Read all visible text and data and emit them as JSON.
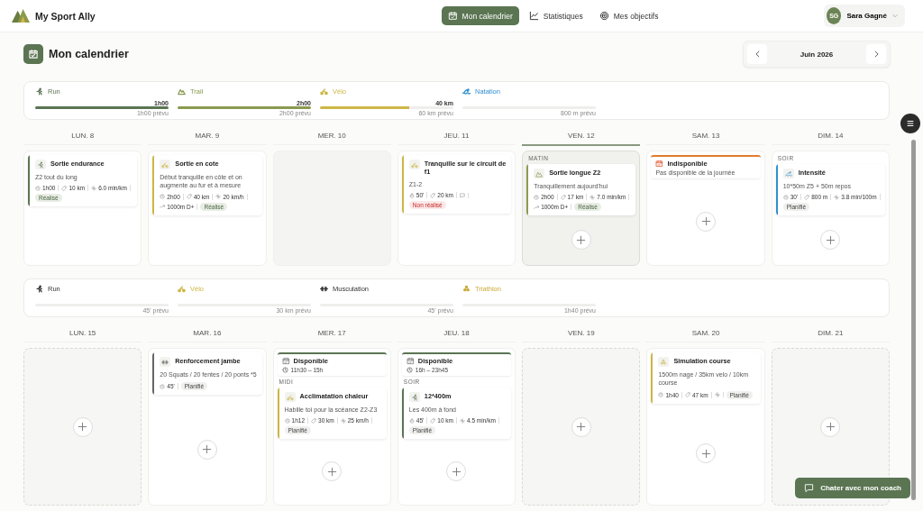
{
  "app": {
    "name": "My Sport Ally"
  },
  "nav": [
    {
      "label": "Mon calendrier",
      "kind": "calendar",
      "selected": true
    },
    {
      "label": "Statistiques",
      "kind": "chart",
      "selected": false
    },
    {
      "label": "Mes objectifs",
      "kind": "target",
      "selected": false
    }
  ],
  "user": {
    "initials": "SG",
    "name": "Sara Gagné"
  },
  "page": {
    "title": "Mon calendrier",
    "month": "Juin 2026"
  },
  "weeks": [
    {
      "summary": [
        {
          "kind": "run",
          "label": "Run",
          "color": "#5b7553",
          "done": "1h00",
          "level": 1,
          "planned": "1h00 prévu"
        },
        {
          "kind": "trail",
          "label": "Trail",
          "color": "#8a9a50",
          "done": "2h00",
          "level": 1,
          "planned": "2h00 prévu"
        },
        {
          "kind": "velo",
          "label": "Vélo",
          "color": "#cdb646",
          "done": "40 km",
          "level": 0.67,
          "planned": "60 km prévu"
        },
        {
          "kind": "natation",
          "label": "Natation",
          "color": "#2f8fcf",
          "level": 0,
          "planned": "800 m prévu"
        }
      ],
      "days": [
        {
          "label": "LUN. 8",
          "selected": false,
          "kind": "plain",
          "add_button": false,
          "items": [
            {
              "kind": "run",
              "color": "#5b7553",
              "title": "Sortie endurance",
              "description": "Z2 tout du long",
              "stats": [
                {
                  "kind": "clock",
                  "text": "1h00"
                },
                {
                  "kind": "distance",
                  "text": "10 km"
                },
                {
                  "kind": "pace",
                  "text": "6.0 min/km"
                }
              ],
              "status": {
                "kind": "done",
                "label": "Réalisé"
              }
            }
          ]
        },
        {
          "label": "MAR. 9",
          "selected": false,
          "kind": "plain",
          "add_button": false,
          "items": [
            {
              "kind": "velo",
              "color": "#cdb646",
              "title": "Sortie en cote",
              "description": "Début tranquille en côte et on augmente au fur et à mesure",
              "stats": [
                {
                  "kind": "clock",
                  "text": "2h00"
                },
                {
                  "kind": "distance",
                  "text": "40 km"
                },
                {
                  "kind": "pace",
                  "text": "20 km/h"
                },
                {
                  "kind": "elevation",
                  "text": "1000m D+"
                }
              ],
              "status": {
                "kind": "done",
                "label": "Réalisé"
              }
            }
          ]
        },
        {
          "label": "MER. 10",
          "selected": false,
          "kind": "past",
          "add_button": false
        },
        {
          "label": "JEU. 11",
          "selected": false,
          "kind": "plain",
          "add_button": false,
          "items": [
            {
              "kind": "velo",
              "color": "#cdb646",
              "title": "Tranquille sur le circuit de f1",
              "description": "Z1-2",
              "stats": [
                {
                  "kind": "timer",
                  "text": "50'"
                },
                {
                  "kind": "distance",
                  "text": "20 km"
                },
                {
                  "kind": "comment"
                }
              ],
              "status": {
                "kind": "missed",
                "label": "Non réalisé"
              }
            }
          ]
        },
        {
          "label": "VEN. 12",
          "selected": true,
          "kind": "plain",
          "add_button": true,
          "items": [
            {
              "kind": "period",
              "text": "MATIN"
            },
            {
              "kind": "trail",
              "color": "#8a9a50",
              "title": "Sortie longue Z2",
              "description": "Tranquillement aujourd'hui",
              "stats": [
                {
                  "kind": "clock",
                  "text": "2h00"
                },
                {
                  "kind": "distance",
                  "text": "17 km"
                },
                {
                  "kind": "pace",
                  "text": "7.0 min/km"
                },
                {
                  "kind": "elevation",
                  "text": "1000m D+"
                }
              ],
              "status": {
                "kind": "done",
                "label": "Réalisé"
              }
            }
          ]
        },
        {
          "label": "SAM. 13",
          "selected": false,
          "kind": "plain",
          "add_button": true,
          "items": [
            {
              "kind": "unavailable",
              "title": "Indisponible",
              "note": "Pas disponible de la journée"
            }
          ]
        },
        {
          "label": "DIM. 14",
          "selected": false,
          "kind": "plain",
          "add_button": true,
          "items": [
            {
              "kind": "period",
              "text": "SOIR"
            },
            {
              "kind": "natation",
              "color": "#2f8fcf",
              "title": "Intensité",
              "description": "10*50m Z5 + 50m repos",
              "stats": [
                {
                  "kind": "clock",
                  "text": "30'"
                },
                {
                  "kind": "distance",
                  "text": "800 m"
                },
                {
                  "kind": "pace",
                  "text": "3.8 min/100m"
                }
              ],
              "status": {
                "kind": "planned",
                "label": "Planifié"
              }
            }
          ]
        }
      ]
    },
    {
      "summary": [
        {
          "kind": "run",
          "label": "Run",
          "color": "#333333",
          "level": 0,
          "planned": "45' prévu"
        },
        {
          "kind": "velo",
          "label": "Vélo",
          "color": "#cdb646",
          "level": 0,
          "planned": "30 km prévu"
        },
        {
          "kind": "musculation",
          "label": "Musculation",
          "color": "#333333",
          "level": 0,
          "planned": "45' prévu"
        },
        {
          "kind": "triathlon",
          "label": "Triathlon",
          "color": "#c9a93a",
          "level": 0,
          "planned": "1h40 prévu"
        }
      ],
      "days": [
        {
          "label": "LUN. 15",
          "selected": false,
          "kind": "empty",
          "add_button": true
        },
        {
          "label": "MAR. 16",
          "selected": false,
          "kind": "plain",
          "add_button": true,
          "items": [
            {
              "kind": "musculation",
              "color": "#666666",
              "title": "Renforcement jambe",
              "description": "20 Squats / 20 fentes / 20 ponts *5",
              "stats": [
                {
                  "kind": "clock",
                  "text": "45'"
                }
              ],
              "status": {
                "kind": "planned",
                "label": "Planifié"
              }
            }
          ]
        },
        {
          "label": "MER. 17",
          "selected": false,
          "kind": "plain",
          "add_button": true,
          "items": [
            {
              "kind": "available",
              "title": "Disponible",
              "time": "11h30 – 15h"
            },
            {
              "kind": "period",
              "text": "MIDI"
            },
            {
              "kind": "velo",
              "color": "#cdb646",
              "title": "Acclimatation chaleur",
              "description": "Habille toi pour la scéance Z2-Z3",
              "stats": [
                {
                  "kind": "clock",
                  "text": "1h12"
                },
                {
                  "kind": "distance",
                  "text": "30 km"
                },
                {
                  "kind": "pace",
                  "text": "25 km/h"
                }
              ],
              "status": {
                "kind": "planned",
                "label": "Planifié"
              }
            }
          ]
        },
        {
          "label": "JEU. 18",
          "selected": false,
          "kind": "plain",
          "add_button": true,
          "items": [
            {
              "kind": "available",
              "title": "Disponible",
              "time": "16h – 23h45"
            },
            {
              "kind": "period",
              "text": "SOIR"
            },
            {
              "kind": "run",
              "color": "#5b7553",
              "title": "12*400m",
              "description": "Les 400m à fond",
              "stats": [
                {
                  "kind": "timer",
                  "text": "45'"
                },
                {
                  "kind": "distance",
                  "text": "10 km"
                },
                {
                  "kind": "pace",
                  "text": "4.5 min/km"
                }
              ],
              "status": {
                "kind": "planned",
                "label": "Planifié"
              }
            }
          ]
        },
        {
          "label": "VEN. 19",
          "selected": false,
          "kind": "empty",
          "add_button": true
        },
        {
          "label": "SAM. 20",
          "selected": false,
          "kind": "plain",
          "add_button": true,
          "items": [
            {
              "kind": "triathlon",
              "color": "#cdb646",
              "title": "Simulation course",
              "description": "1500m nage / 35km velo / 10km course",
              "stats": [
                {
                  "kind": "clock",
                  "text": "1h40"
                },
                {
                  "kind": "distance",
                  "text": "47 km"
                },
                {
                  "kind": "pace"
                }
              ],
              "status": {
                "kind": "planned",
                "label": "Planifié"
              }
            }
          ]
        },
        {
          "label": "DIM. 21",
          "selected": false,
          "kind": "empty",
          "add_button": true
        }
      ]
    }
  ],
  "chat_button": "Chater avec mon coach"
}
